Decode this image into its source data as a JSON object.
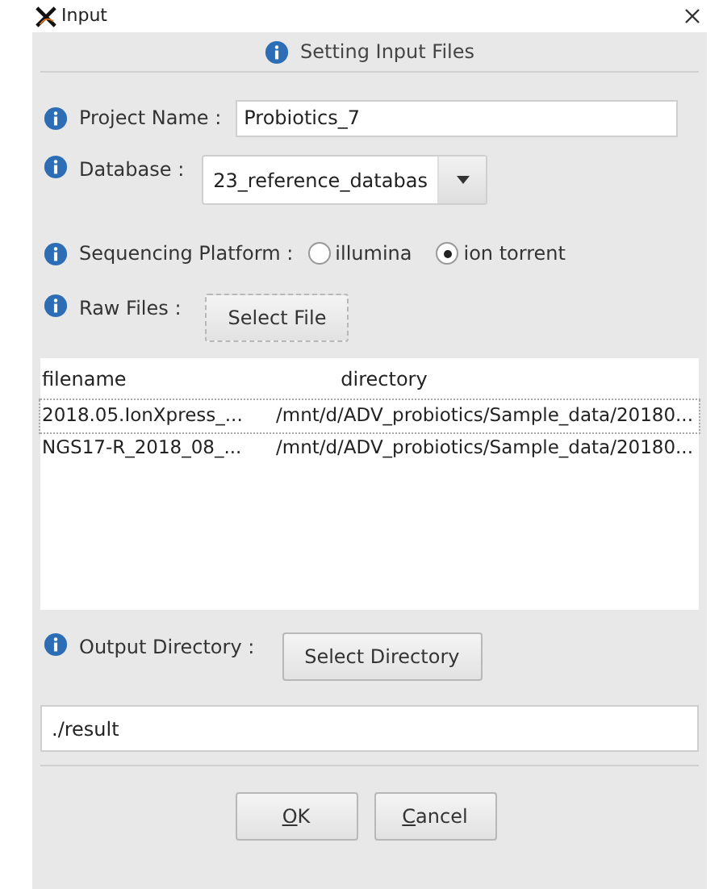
{
  "window": {
    "title": "Input"
  },
  "header": "Setting Input Files",
  "project_name": {
    "label": "Project Name :",
    "value": "Probiotics_7"
  },
  "database": {
    "label": "Database :",
    "value": "23_reference_databas"
  },
  "sequencing_platform": {
    "label": "Sequencing Platform :",
    "options": [
      {
        "label": "illumina",
        "selected": false
      },
      {
        "label": "ion torrent",
        "selected": true
      }
    ]
  },
  "raw_files": {
    "label": "Raw Files :",
    "button": "Select File"
  },
  "table": {
    "columns": [
      "filename",
      "directory"
    ],
    "rows": [
      [
        "2018.05.IonXpress_...",
        "/mnt/d/ADV_probiotics/Sample_data/20180..."
      ],
      [
        "NGS17-R_2018_08_...",
        "/mnt/d/ADV_probiotics/Sample_data/20180..."
      ]
    ]
  },
  "output_directory": {
    "label": "Output Directory :",
    "button": "Select Directory",
    "value": "./result"
  },
  "buttons": [
    "OK",
    "Cancel"
  ]
}
